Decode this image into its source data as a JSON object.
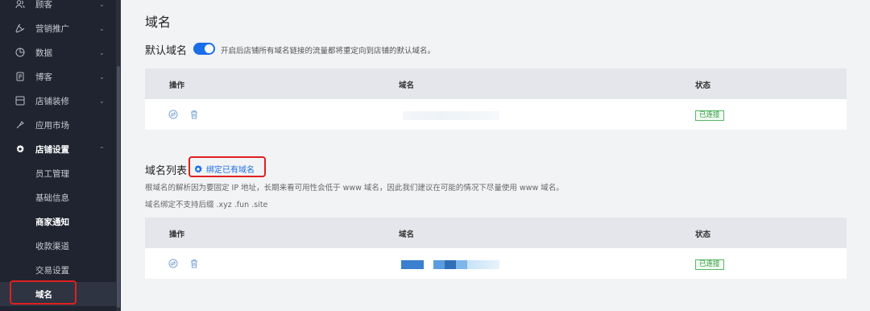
{
  "sidebar": {
    "items": [
      {
        "label": "顾客",
        "icon": "users-icon"
      },
      {
        "label": "营销推广",
        "icon": "megaphone-icon"
      },
      {
        "label": "数据",
        "icon": "chart-icon"
      },
      {
        "label": "博客",
        "icon": "document-icon"
      },
      {
        "label": "店铺装修",
        "icon": "layout-icon"
      },
      {
        "label": "应用市场",
        "icon": "plugin-icon"
      },
      {
        "label": "店铺设置",
        "icon": "gear-icon"
      }
    ],
    "sub_items": [
      {
        "label": "员工管理"
      },
      {
        "label": "基础信息"
      },
      {
        "label": "商家通知"
      },
      {
        "label": "收款渠道"
      },
      {
        "label": "交易设置"
      },
      {
        "label": "域名"
      }
    ]
  },
  "page": {
    "title": "域名",
    "default_domain": {
      "title": "默认域名",
      "toggle_on": true,
      "hint": "开启后店铺所有域名链接的流量都将重定向到店铺的默认域名。",
      "columns": [
        "操作",
        "域名",
        "状态"
      ],
      "rows": [
        {
          "status": "已连接"
        }
      ]
    },
    "domain_list": {
      "title": "域名列表",
      "bind_button": "绑定已有域名",
      "hint1": "根域名的解析因为要固定 IP 地址，长期来看可用性会低于 www 域名，因此我们建议在可能的情况下尽量使用 www 域名。",
      "hint2": "域名绑定不支持后缀 .xyz .fun .site",
      "columns": [
        "操作",
        "域名",
        "状态"
      ],
      "rows": [
        {
          "status": "已连接"
        }
      ]
    }
  },
  "colors": {
    "accent": "#1a6fe8",
    "sidebar_bg": "#1f2430",
    "status_green": "#2b9a3a",
    "highlight_red": "#e02020"
  }
}
